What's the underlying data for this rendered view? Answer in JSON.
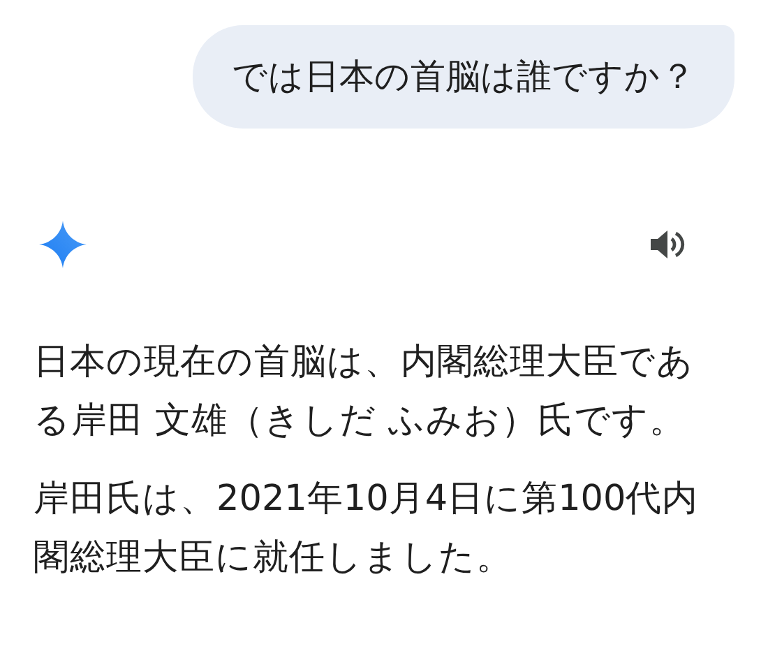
{
  "user_message": {
    "text": "では日本の首脳は誰ですか？"
  },
  "response": {
    "paragraphs": [
      "日本の現在の首脳は、内閣総理大臣である岸田 文雄（きしだ ふみお）氏です。",
      "岸田氏は、2021年10月4日に第100代内閣総理大臣に就任しました。"
    ]
  }
}
